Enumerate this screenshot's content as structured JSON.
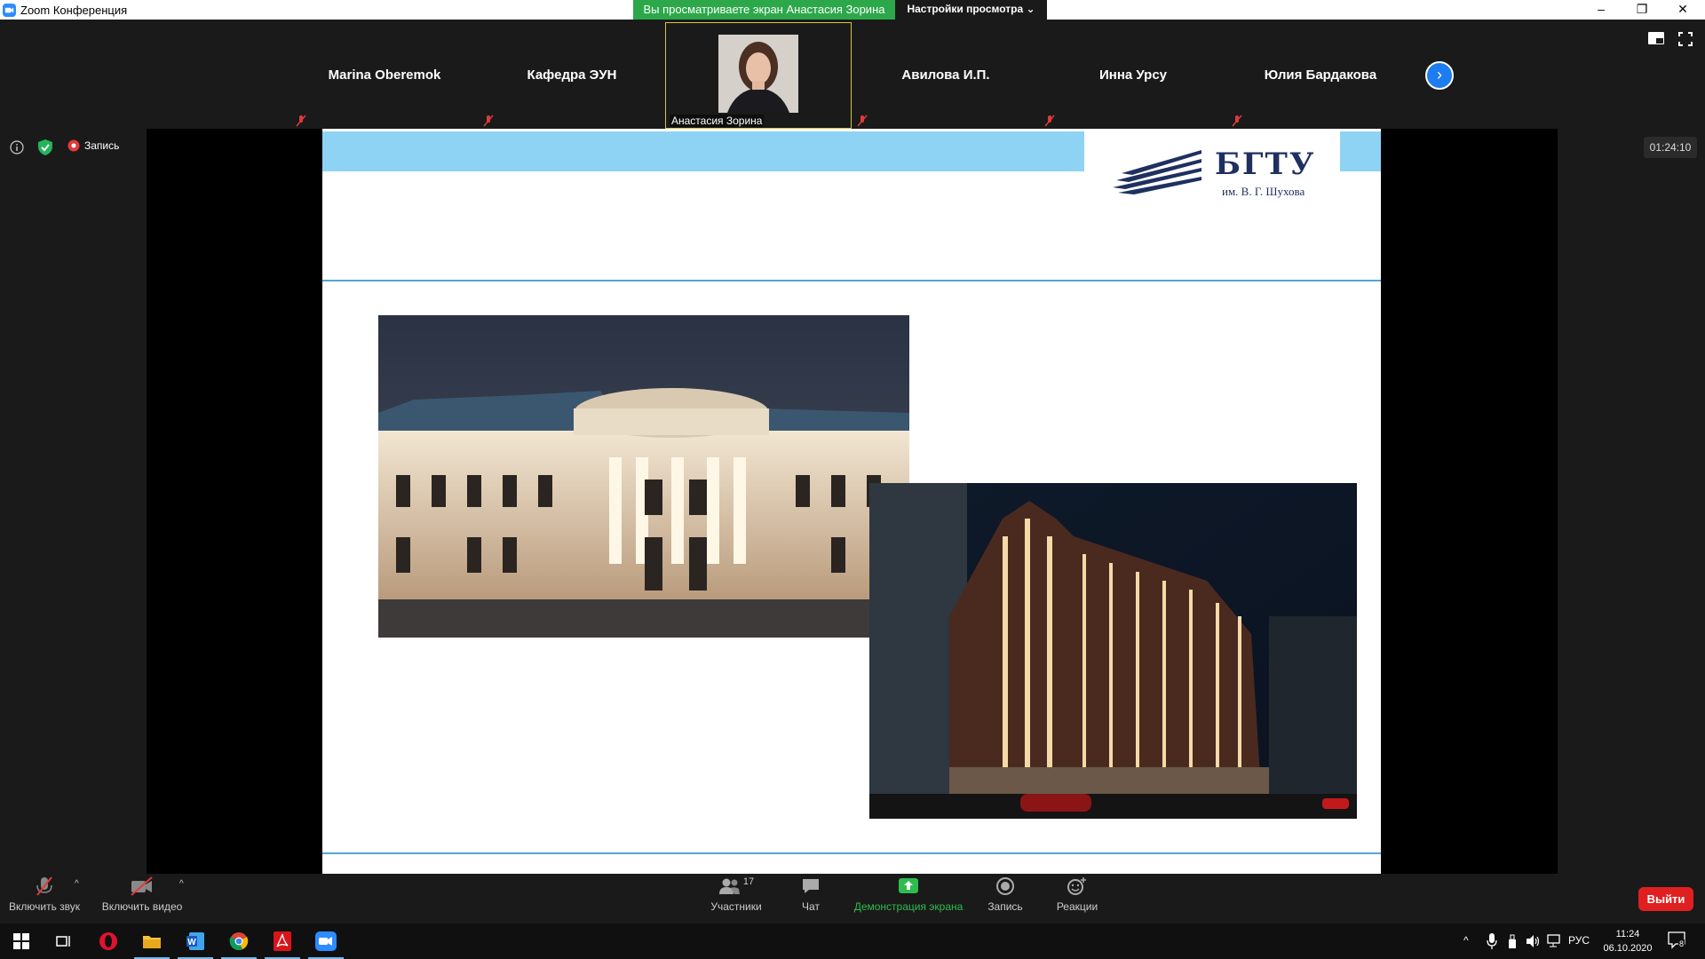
{
  "window": {
    "title": "Zoom Конференция",
    "viewing_banner": "Вы просматриваете экран Анастасия Зорина",
    "view_options": "Настройки просмотра"
  },
  "gallery": [
    {
      "name": "Marina Oberemok"
    },
    {
      "name": "Кафедра ЭУН"
    },
    {
      "name": "Анастасия Зорина",
      "active": true
    },
    {
      "name": "Авилова И.П."
    },
    {
      "name": "Инна Урсу"
    },
    {
      "name": "Юлия Бардакова"
    }
  ],
  "status": {
    "recording_label": "Запись",
    "timer": "01:24:10"
  },
  "slide": {
    "logo_text": "БГТУ",
    "logo_sub": "им. В. Г. Шухова"
  },
  "toolbar": {
    "unmute": "Включить звук",
    "start_video": "Включить видео",
    "participants": "Участники",
    "participants_count": "17",
    "chat": "Чат",
    "share_screen": "Демонстрация экрана",
    "record": "Запись",
    "reactions": "Реакции",
    "leave": "Выйти"
  },
  "taskbar": {
    "language": "РУС",
    "time": "11:24",
    "date": "06.10.2020",
    "notifications": "8"
  },
  "colors": {
    "share_green": "#2ca84a",
    "leave_red": "#e02020",
    "slide_band": "#8fd3f4",
    "zoom_blue": "#1c7cf0"
  }
}
